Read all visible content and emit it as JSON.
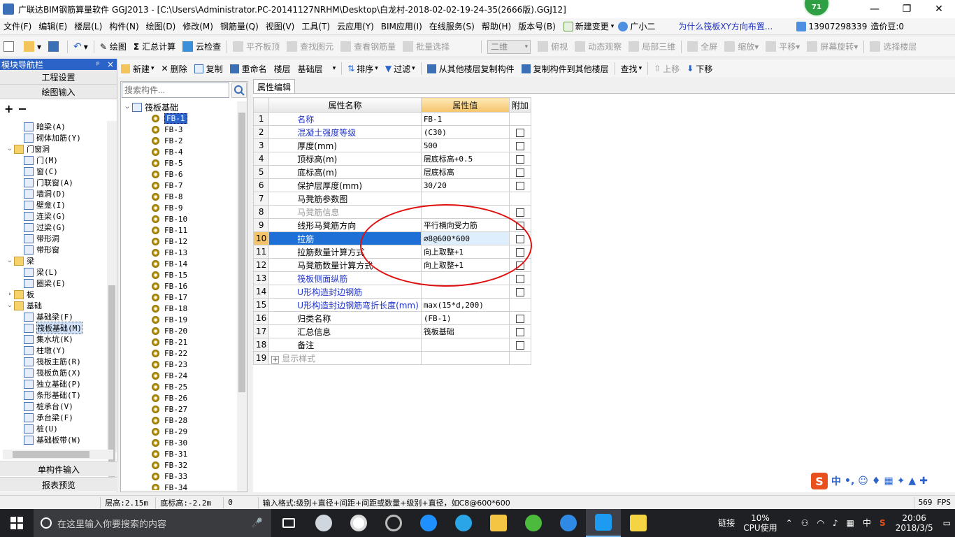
{
  "window": {
    "title": "广联达BIM钢筋算量软件 GGJ2013 - [C:\\Users\\Administrator.PC-20141127NRHM\\Desktop\\白龙村-2018-02-02-19-24-35(2666版).GGJ12]",
    "badge": "71",
    "minimize": "—",
    "restore": "❐",
    "close": "✕"
  },
  "menu": {
    "items": [
      "文件(F)",
      "编辑(E)",
      "楼层(L)",
      "构件(N)",
      "绘图(D)",
      "修改(M)",
      "钢筋量(Q)",
      "视图(V)",
      "工具(T)",
      "云应用(Y)",
      "BIM应用(I)",
      "在线服务(S)",
      "帮助(H)",
      "版本号(B)"
    ],
    "new_change": "新建变更",
    "guangxiaoer": "广小二",
    "question": "为什么筏板XY方向布置...",
    "phone": "13907298339",
    "price_bean": "造价豆:0"
  },
  "toolbar": {
    "draw": "绘图",
    "sum_calc": "汇总计算",
    "cloud_check": "云检查",
    "flush_slab_top": "平齐板顶",
    "find_element": "查找图元",
    "view_rebar": "查看钢筋量",
    "batch_select": "批量选择",
    "view_mode": "二维",
    "top_view": "俯视",
    "dynamic_view": "动态观察",
    "local_3d": "局部三维",
    "full_screen": "全屏",
    "zoom": "缩放",
    "pan": "平移",
    "screen_rotate": "屏幕旋转",
    "select_floor": "选择楼层"
  },
  "nav": {
    "header": "模块导航栏",
    "pin": "ᵖ",
    "close": "×",
    "project_settings": "工程设置",
    "drawing_input": "绘图输入",
    "single_input": "单构件输入",
    "report_preview": "报表预览",
    "tree": [
      {
        "level": 2,
        "label": "暗梁(A)",
        "icon": "beam-icon"
      },
      {
        "level": 2,
        "label": "砌体加筋(Y)",
        "icon": "masonry-icon"
      },
      {
        "level": 1,
        "label": "门窗洞",
        "folder": true,
        "expanded": true
      },
      {
        "level": 2,
        "label": "门(M)",
        "icon": "door-icon"
      },
      {
        "level": 2,
        "label": "窗(C)",
        "icon": "window-icon"
      },
      {
        "level": 2,
        "label": "门联窗(A)",
        "icon": "door-window-icon"
      },
      {
        "level": 2,
        "label": "墙洞(D)",
        "icon": "wall-hole-icon"
      },
      {
        "level": 2,
        "label": "壁龛(I)",
        "icon": "niche-icon"
      },
      {
        "level": 2,
        "label": "连梁(G)",
        "icon": "link-beam-icon"
      },
      {
        "level": 2,
        "label": "过梁(G)",
        "icon": "lintel-icon"
      },
      {
        "level": 2,
        "label": "带形洞",
        "icon": "strip-hole-icon"
      },
      {
        "level": 2,
        "label": "带形窗",
        "icon": "strip-window-icon"
      },
      {
        "level": 1,
        "label": "梁",
        "folder": true,
        "expanded": true
      },
      {
        "level": 2,
        "label": "梁(L)",
        "icon": "beam-icon"
      },
      {
        "level": 2,
        "label": "圈梁(E)",
        "icon": "ring-beam-icon"
      },
      {
        "level": 1,
        "label": "板",
        "folder": true,
        "expanded": false
      },
      {
        "level": 1,
        "label": "基础",
        "folder": true,
        "expanded": true
      },
      {
        "level": 2,
        "label": "基础梁(F)",
        "icon": "foundation-beam-icon"
      },
      {
        "level": 2,
        "label": "筏板基础(M)",
        "icon": "raft-foundation-icon",
        "selected": true
      },
      {
        "level": 2,
        "label": "集水坑(K)",
        "icon": "sump-icon"
      },
      {
        "level": 2,
        "label": "柱墩(Y)",
        "icon": "column-pier-icon"
      },
      {
        "level": 2,
        "label": "筏板主筋(R)",
        "icon": "raft-main-rebar-icon"
      },
      {
        "level": 2,
        "label": "筏板负筋(X)",
        "icon": "raft-neg-rebar-icon"
      },
      {
        "level": 2,
        "label": "独立基础(P)",
        "icon": "isolated-footing-icon"
      },
      {
        "level": 2,
        "label": "条形基础(T)",
        "icon": "strip-footing-icon"
      },
      {
        "level": 2,
        "label": "桩承台(V)",
        "icon": "pile-cap-icon"
      },
      {
        "level": 2,
        "label": "承台梁(F)",
        "icon": "cap-beam-icon"
      },
      {
        "level": 2,
        "label": "桩(U)",
        "icon": "pile-icon"
      },
      {
        "level": 2,
        "label": "基础板带(W)",
        "icon": "foundation-strip-icon"
      }
    ]
  },
  "toolbar2": {
    "new": "新建",
    "delete": "删除",
    "copy": "复制",
    "rename": "重命名",
    "floor_label": "楼层",
    "floor_value": "基础层",
    "sort": "排序",
    "filter": "过滤",
    "copy_from_other": "从其他楼层复制构件",
    "copy_to_other": "复制构件到其他楼层",
    "find": "查找",
    "move_up": "上移",
    "move_down": "下移"
  },
  "components": {
    "search_placeholder": "搜索构件...",
    "root": "筏板基础",
    "items": [
      "FB-1",
      "FB-3",
      "FB-2",
      "FB-4",
      "FB-5",
      "FB-6",
      "FB-7",
      "FB-8",
      "FB-9",
      "FB-10",
      "FB-11",
      "FB-12",
      "FB-13",
      "FB-14",
      "FB-15",
      "FB-16",
      "FB-17",
      "FB-18",
      "FB-19",
      "FB-20",
      "FB-21",
      "FB-22",
      "FB-23",
      "FB-24",
      "FB-25",
      "FB-26",
      "FB-27",
      "FB-28",
      "FB-29",
      "FB-30",
      "FB-31",
      "FB-32",
      "FB-33",
      "FB-34"
    ]
  },
  "props": {
    "tab": "属性编辑",
    "head_name": "属性名称",
    "head_value": "属性值",
    "head_add": "附加",
    "rows": [
      {
        "n": "1",
        "name": "名称",
        "value": "FB-1",
        "color": "blue",
        "check": false
      },
      {
        "n": "2",
        "name": "混凝土强度等级",
        "value": "(C30)",
        "color": "blue",
        "check": true
      },
      {
        "n": "3",
        "name": "厚度(mm)",
        "value": "500",
        "color": "black",
        "check": true
      },
      {
        "n": "4",
        "name": "顶标高(m)",
        "value": "层底标高+0.5",
        "color": "black",
        "check": true
      },
      {
        "n": "5",
        "name": "底标高(m)",
        "value": "层底标高",
        "color": "black",
        "check": true
      },
      {
        "n": "6",
        "name": "保护层厚度(mm)",
        "value": "30/20",
        "color": "black",
        "check": true
      },
      {
        "n": "7",
        "name": "马凳筋参数图",
        "value": "",
        "color": "black",
        "check": false
      },
      {
        "n": "8",
        "name": "马凳筋信息",
        "value": "",
        "color": "grey",
        "check": true
      },
      {
        "n": "9",
        "name": "线形马凳筋方向",
        "value": "平行横向受力筋",
        "color": "black",
        "check": true
      },
      {
        "n": "10",
        "name": "拉筋",
        "value": "⌀8@600*600",
        "color": "black",
        "check": true,
        "selected": true
      },
      {
        "n": "11",
        "name": "拉筋数量计算方式",
        "value": "向上取整+1",
        "color": "black",
        "check": true
      },
      {
        "n": "12",
        "name": "马凳筋数量计算方式",
        "value": "向上取整+1",
        "color": "black",
        "check": true
      },
      {
        "n": "13",
        "name": "筏板侧面纵筋",
        "value": "",
        "color": "blue",
        "check": true
      },
      {
        "n": "14",
        "name": "U形构造封边钢筋",
        "value": "",
        "color": "blue",
        "check": true
      },
      {
        "n": "15",
        "name": "U形构造封边钢筋弯折长度(mm)",
        "value": "max(15*d,200)",
        "color": "blue",
        "check": false
      },
      {
        "n": "16",
        "name": "归类名称",
        "value": "(FB-1)",
        "color": "black",
        "check": true
      },
      {
        "n": "17",
        "name": "汇总信息",
        "value": "筏板基础",
        "color": "black",
        "check": true
      },
      {
        "n": "18",
        "name": "备注",
        "value": "",
        "color": "black",
        "check": true
      },
      {
        "n": "19",
        "name": "显示样式",
        "value": "",
        "color": "grey",
        "check": false,
        "expand": true
      }
    ]
  },
  "status": {
    "floor_height": "层高:2.15m",
    "base_height": "底标高:-2.2m",
    "zero": "0",
    "input_hint": "输入格式:级别+直径+间距+间距或数量+级别+直径，如C8@600*600",
    "fps": "569 FPS"
  },
  "ime": {
    "logo": "S",
    "lang": "中",
    "punct": "•,"
  },
  "taskbar": {
    "search": "在这里输入你要搜索的内容",
    "link": "链接",
    "cpu_pct": "10%",
    "cpu_label": "CPU使用",
    "tray_lang": "中",
    "time": "20:06",
    "date": "2018/3/5"
  }
}
